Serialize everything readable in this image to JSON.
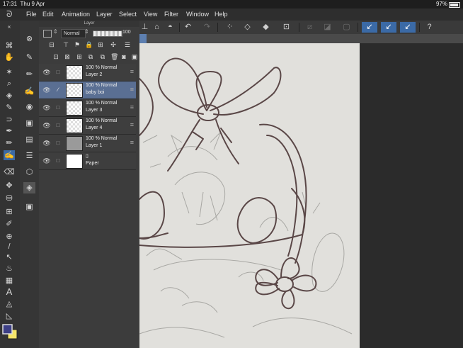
{
  "statusbar": {
    "time": "17:31",
    "date": "Thu 9 Apr",
    "battery": "97%"
  },
  "menu": [
    "File",
    "Edit",
    "Animation",
    "Layer",
    "Select",
    "View",
    "Filter",
    "Window",
    "Help"
  ],
  "layer_panel": {
    "title": "Layer",
    "blend_mode": "Normal",
    "opacity": "100",
    "layers": [
      {
        "mode": "100 % Normal",
        "name": "Layer 2",
        "thumb": "checker",
        "selected": false
      },
      {
        "mode": "100 % Normal",
        "name": "baby boi",
        "thumb": "checker",
        "selected": true
      },
      {
        "mode": "100 % Normal",
        "name": "Layer 3",
        "thumb": "checker",
        "selected": false
      },
      {
        "mode": "100 % Normal",
        "name": "Layer 4",
        "thumb": "checker",
        "selected": false
      },
      {
        "mode": "100 % Normal",
        "name": "Layer 1",
        "thumb": "photo",
        "selected": false
      },
      {
        "mode": "",
        "name": "Paper",
        "thumb": "paper",
        "selected": false
      }
    ]
  },
  "colors": {
    "main": "#3d3f86",
    "sub": "#f5e46a",
    "accent": "#3b6aa6",
    "line": "#5a4747"
  }
}
